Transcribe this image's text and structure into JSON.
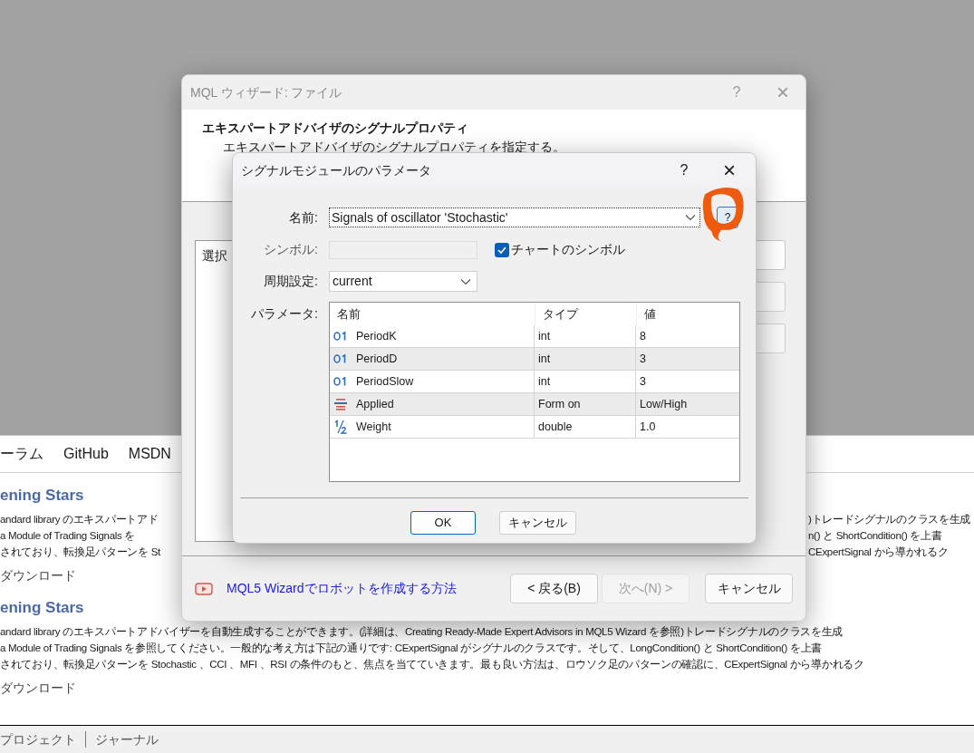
{
  "background_page": {
    "tabs": [
      "ーラム",
      "GitHub",
      "MSDN"
    ],
    "articles": [
      {
        "title": "ening Stars",
        "lines": [
          {
            "left": "andard library のエキスパートアド",
            "right": ")トレードシグナルのクラスを生成"
          },
          {
            "left": "a Module of Trading Signals を",
            "right": "n() と ShortCondition() を上書"
          },
          {
            "left": "されており、転換足パターンを St",
            "right": "CExpertSignal から導かれるク"
          }
        ],
        "download": "ダウンロード"
      },
      {
        "title": "ening Stars",
        "lines": [
          {
            "text": "andard library のエキスパートアドバイザーを自動生成することができます。(詳細は、Creating Ready-Made Expert Advisors in MQL5 Wizard を参照)トレードシグナルのクラスを生成"
          },
          {
            "text": "a Module of Trading Signals を参照してください。一般的な考え方は下記の通りです: CExpertSignal がシグナルのクラスです。そして、LongCondition() と ShortCondition() を上書"
          },
          {
            "text": "されており、転換足パターンを Stochastic 、CCI 、MFI 、RSI の条件のもと、焦点を当てていきます。最も良い方法は、ロウソク足のパターンの確認に、CExpertSignal から導かれるク"
          }
        ],
        "download": "ダウンロード"
      }
    ],
    "status_bar": [
      "プロジェクト",
      "ジャーナル"
    ]
  },
  "wizard": {
    "title": "MQL ウィザード: ファイル",
    "help": "?",
    "close": "×",
    "heading": "エキスパートアドバイザのシグナルプロパティ",
    "subheading": "エキスパートアドバイザのシグナルプロパティを指定する。",
    "list_text": "選択",
    "video_link": "MQL5 Wizardでロボットを作成する方法",
    "buttons": [
      {
        "label": "< 戻る(B)",
        "disabled": false
      },
      {
        "label": "次へ(N) >",
        "disabled": true
      },
      {
        "label": "キャンセル",
        "disabled": false
      }
    ]
  },
  "signal_dialog": {
    "title": "シグナルモジュールのパラメータ",
    "help": "?",
    "close": "×",
    "name_label": "名前:",
    "name_value": "Signals of oscillator 'Stochastic'",
    "name_help": "?",
    "symbol_label": "シンボル:",
    "chart_symbol": {
      "label": "チャートのシンボル",
      "checked": true
    },
    "period_label": "周期設定:",
    "period_value": "current",
    "params_label": "パラメータ:",
    "columns": [
      "名前",
      "タイプ",
      "値"
    ],
    "rows": [
      {
        "kind": "int",
        "name": "PeriodK",
        "type": "int",
        "value": "8"
      },
      {
        "kind": "int",
        "name": "PeriodD",
        "type": "int",
        "value": "3"
      },
      {
        "kind": "int",
        "name": "PeriodSlow",
        "type": "int",
        "value": "3"
      },
      {
        "kind": "enum",
        "name": "Applied",
        "type": "Form on",
        "value": "Low/High"
      },
      {
        "kind": "double",
        "name": "Weight",
        "type": "double",
        "value": "1.0"
      }
    ],
    "buttons": [
      "OK",
      "キャンセル"
    ]
  }
}
